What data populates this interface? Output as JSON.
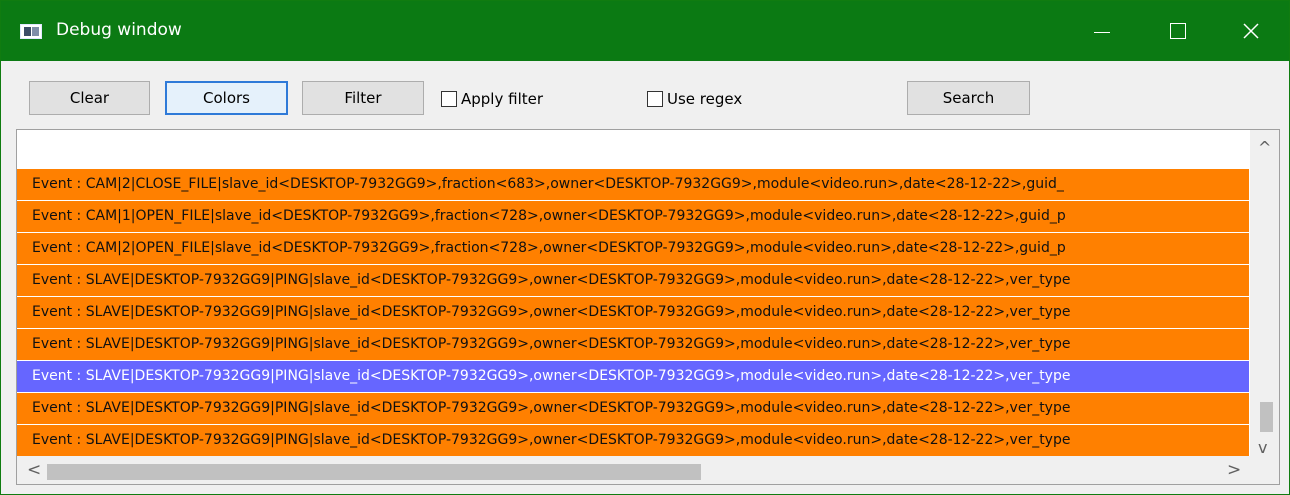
{
  "window": {
    "title": "Debug window",
    "controls": {
      "minimize": "—",
      "maximize": "",
      "close": "✕"
    }
  },
  "toolbar": {
    "clear_label": "Clear",
    "colors_label": "Colors",
    "filter_label": "Filter",
    "apply_filter_label": "Apply filter",
    "use_regex_label": "Use regex",
    "search_label": "Search",
    "apply_filter_checked": false,
    "use_regex_checked": false
  },
  "log": {
    "rows": [
      "Event : CAM|2|CLOSE_FILE|slave_id<DESKTOP-7932GG9>,fraction<683>,owner<DESKTOP-7932GG9>,module<video.run>,date<28-12-22>,guid_",
      "Event : CAM|1|OPEN_FILE|slave_id<DESKTOP-7932GG9>,fraction<728>,owner<DESKTOP-7932GG9>,module<video.run>,date<28-12-22>,guid_p",
      "Event : CAM|2|OPEN_FILE|slave_id<DESKTOP-7932GG9>,fraction<728>,owner<DESKTOP-7932GG9>,module<video.run>,date<28-12-22>,guid_p",
      "Event : SLAVE|DESKTOP-7932GG9|PING|slave_id<DESKTOP-7932GG9>,owner<DESKTOP-7932GG9>,module<video.run>,date<28-12-22>,ver_type",
      "Event : SLAVE|DESKTOP-7932GG9|PING|slave_id<DESKTOP-7932GG9>,owner<DESKTOP-7932GG9>,module<video.run>,date<28-12-22>,ver_type",
      "Event : SLAVE|DESKTOP-7932GG9|PING|slave_id<DESKTOP-7932GG9>,owner<DESKTOP-7932GG9>,module<video.run>,date<28-12-22>,ver_type",
      "Event : SLAVE|DESKTOP-7932GG9|PING|slave_id<DESKTOP-7932GG9>,owner<DESKTOP-7932GG9>,module<video.run>,date<28-12-22>,ver_type",
      "Event : SLAVE|DESKTOP-7932GG9|PING|slave_id<DESKTOP-7932GG9>,owner<DESKTOP-7932GG9>,module<video.run>,date<28-12-22>,ver_type",
      "Event : SLAVE|DESKTOP-7932GG9|PING|slave_id<DESKTOP-7932GG9>,owner<DESKTOP-7932GG9>,module<video.run>,date<28-12-22>,ver_type"
    ],
    "selected_row": 6,
    "row_color": "#ff8000",
    "selected_row_color": "#6666ff",
    "up_arrow": "^",
    "down_arrow": "v",
    "left_arrow": "<",
    "right_arrow": ">"
  },
  "colors": {
    "title_bar": "#0b7a13",
    "focused_button_border": "#2f7ad8"
  }
}
